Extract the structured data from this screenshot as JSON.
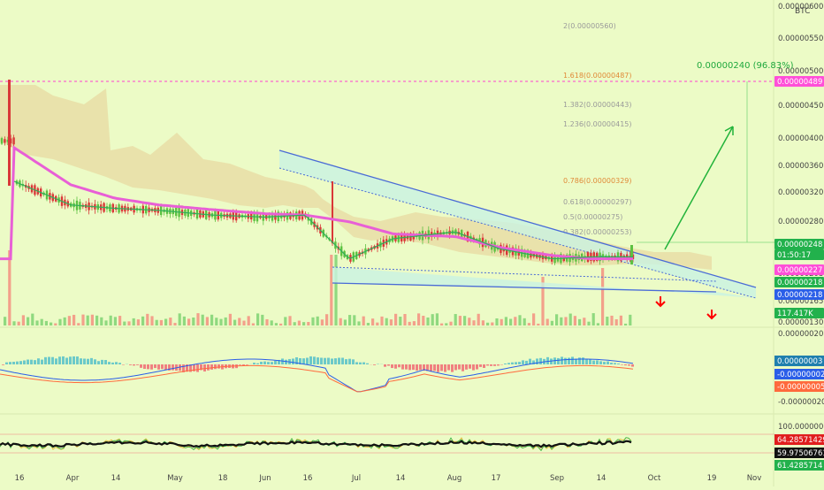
{
  "currency": "BTC",
  "colors": {
    "background": "#ecfbc6",
    "candle_up": "#5dc141",
    "candle_down": "#d93838",
    "ma_line": "#e85fd6",
    "ma_fast": "#2fae5a",
    "ichimoku_cloud": "#e8d9a2",
    "trend_line": "#4a6bd6",
    "channel_fill": "#c9f3e2",
    "target_arrow": "#22b33a",
    "down_arrow": "#ff0000",
    "fib_label": "#9a9a9a",
    "fib_highlight": "#e08a38",
    "target_line": "#ff3fd0",
    "vol_up": "#8fd97f",
    "vol_down": "#f3a08a"
  },
  "price_axis": {
    "ticks": [
      "0.00000600",
      "0.00000550",
      "0.00000500",
      "0.00000450",
      "0.00000400",
      "0.00000360",
      "0.00000320",
      "0.00000280",
      "0.00000240",
      "0.00000203",
      "0.00000165",
      "0.00000130"
    ],
    "badges": [
      {
        "label": "0.00000489",
        "bg": "#ff4fd8",
        "fg": "#ffffff"
      },
      {
        "label": "0.00000248",
        "bg": "#22b14c",
        "fg": "#ffffff"
      },
      {
        "label": "01:50:17",
        "bg": "#22b14c",
        "fg": "#ffffff"
      },
      {
        "label": "0.00000227",
        "bg": "#ff4fd8",
        "fg": "#ffffff"
      },
      {
        "label": "0.00000218",
        "bg": "#22b14c",
        "fg": "#ffffff"
      },
      {
        "label": "0.00000218",
        "bg": "#2a5ee8",
        "fg": "#ffffff"
      },
      {
        "label": "117.417K",
        "bg": "#22b14c",
        "fg": "#ffffff"
      }
    ],
    "volume_label": "0.00000020"
  },
  "macd_axis": {
    "ticks": [
      "-0.00000020"
    ],
    "badges": [
      {
        "label": "0.00000003",
        "bg": "#1f7fae",
        "fg": "#ffffff"
      },
      {
        "label": "-0.00000002",
        "bg": "#2a5ee8",
        "fg": "#ffffff"
      },
      {
        "label": "-0.00000005",
        "bg": "#ff6a3d",
        "fg": "#ffffff"
      }
    ]
  },
  "rsi_axis": {
    "ticks": [
      "100.00000000"
    ],
    "badges": [
      {
        "label": "64.28571429",
        "bg": "#e01d1d",
        "fg": "#ffffff"
      },
      {
        "label": "59.97506761",
        "bg": "#111111",
        "fg": "#ffffff"
      },
      {
        "label": "61.4285714",
        "bg": "#22b14c",
        "fg": "#ffffff"
      }
    ]
  },
  "time_axis": [
    "16",
    "Apr",
    "14",
    "May",
    "18",
    "Jun",
    "16",
    "Jul",
    "14",
    "Aug",
    "17",
    "Sep",
    "14",
    "Oct",
    "19",
    "Nov"
  ],
  "fib_levels": [
    {
      "label": "2(0.00000560)",
      "highlight": false
    },
    {
      "label": "1.618(0.00000487)",
      "highlight": true
    },
    {
      "label": "1.382(0.00000443)",
      "highlight": false
    },
    {
      "label": "1.236(0.00000415)",
      "highlight": false
    },
    {
      "label": "0.786(0.00000329)",
      "highlight": true
    },
    {
      "label": "0.618(0.00000297)",
      "highlight": false
    },
    {
      "label": "0.5(0.00000275)",
      "highlight": false
    },
    {
      "label": "0.382(0.00000253)",
      "highlight": false
    }
  ],
  "target_label": "0.00000240 (96.83%)",
  "chart_data": {
    "type": "line",
    "subtitle": "BTC",
    "x_labels": [
      "16",
      "Apr",
      "14",
      "May",
      "18",
      "Jun",
      "16",
      "Jul",
      "14",
      "Aug",
      "17",
      "Sep",
      "14",
      "Oct",
      "19",
      "Nov"
    ],
    "y_ticks": [
      "0.00000600",
      "0.00000550",
      "0.00000500",
      "0.00000450",
      "0.00000400",
      "0.00000360",
      "0.00000320",
      "0.00000280",
      "0.00000240",
      "0.00000203",
      "0.00000165",
      "0.00000130"
    ],
    "series": [
      {
        "x": [
          "16",
          "Apr",
          "14",
          "May",
          "18",
          "Jun",
          "16",
          "Jul",
          "14",
          "Aug",
          "17",
          "Sep",
          "14"
        ],
        "values": [
          3.4e-06,
          3.05e-06,
          3e-06,
          2.97e-06,
          2.9e-06,
          2.87e-06,
          2.9e-06,
          2.25e-06,
          2.55e-06,
          2.65e-06,
          2.4e-06,
          2.25e-06,
          2.28e-06
        ]
      },
      {
        "x": [
          "16",
          "Apr",
          "14",
          "May",
          "18",
          "Jun",
          "16",
          "Jul",
          "14",
          "Aug",
          "17",
          "Sep",
          "14"
        ],
        "values": [
          3.9e-06,
          3.35e-06,
          3.15e-06,
          3.05e-06,
          2.98e-06,
          2.92e-06,
          2.9e-06,
          2.8e-06,
          2.62e-06,
          2.58e-06,
          2.42e-06,
          2.3e-06,
          2.25e-06
        ]
      }
    ],
    "annotations": [
      "0.00000240 (96.83%)",
      "1.618(0.00000487)",
      "0.786(0.00000329)"
    ]
  }
}
